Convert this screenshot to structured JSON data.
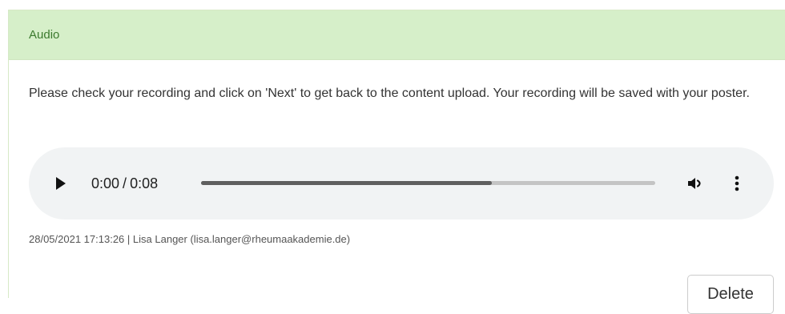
{
  "panel": {
    "title": "Audio"
  },
  "message": "Please check your recording and click on 'Next' to get back to the content upload. Your recording will be saved with your poster.",
  "audio_player": {
    "current_time": "0:00",
    "separator": "/",
    "duration": "0:08",
    "progress_fraction": 0.64,
    "play_icon": "play-icon",
    "volume_icon": "volume-icon",
    "menu_icon": "more-vertical-icon"
  },
  "meta": {
    "timestamp": "28/05/2021 17:13:26",
    "divider": "|",
    "user": "Lisa Langer (lisa.langer@rheumaakademie.de)"
  },
  "actions": {
    "delete_label": "Delete"
  },
  "colors": {
    "heading_bg": "#d6efc9",
    "heading_text": "#3c7a2e",
    "player_bg": "#f1f3f4"
  }
}
